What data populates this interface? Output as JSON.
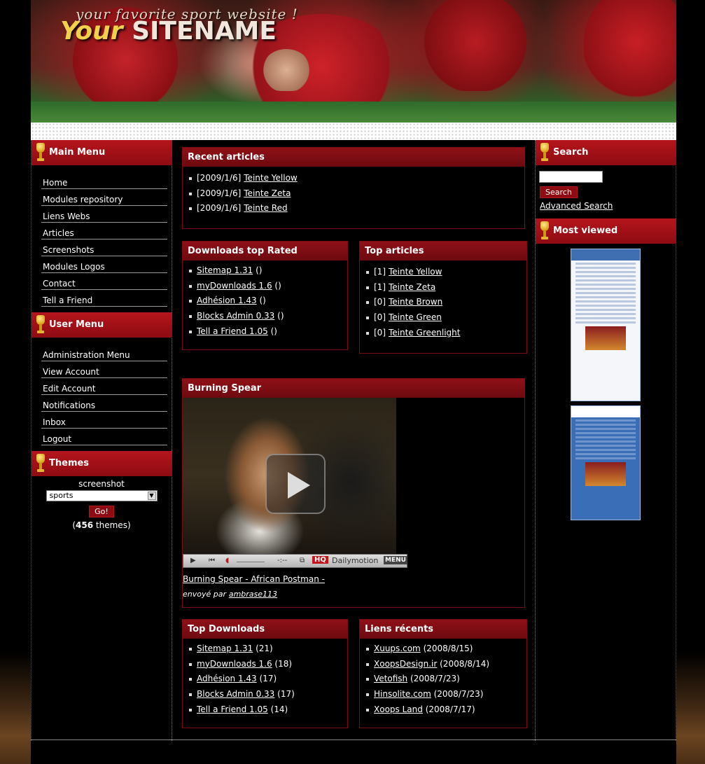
{
  "header": {
    "tagline": "your favorite sport website !",
    "site_name_part1": "Your",
    "site_name_part2": "SITENAME"
  },
  "main_menu": {
    "title": "Main Menu",
    "items": [
      "Home",
      "Modules repository",
      "Liens Webs",
      "Articles",
      "Screenshots",
      "Modules Logos",
      "Contact",
      "Tell a Friend"
    ]
  },
  "user_menu": {
    "title": "User Menu",
    "items": [
      "Administration Menu",
      "View Account",
      "Edit Account",
      "Notifications",
      "Inbox",
      "Logout"
    ]
  },
  "themes": {
    "title": "Themes",
    "label": "screenshot",
    "selected": "sports",
    "go_label": "Go!",
    "count_open": "(",
    "count": "456",
    "count_close": " themes)"
  },
  "recent_articles": {
    "title": "Recent articles",
    "items": [
      {
        "date": "[2009/1/6]",
        "title": "Teinte Yellow"
      },
      {
        "date": "[2009/1/6]",
        "title": "Teinte Zeta"
      },
      {
        "date": "[2009/1/6]",
        "title": "Teinte Red"
      }
    ]
  },
  "downloads_top_rated": {
    "title": "Downloads top Rated",
    "items": [
      {
        "name": "Sitemap 1.31",
        "value": "()"
      },
      {
        "name": "myDownloads 1.6",
        "value": "()"
      },
      {
        "name": "Adhésion 1.43",
        "value": "()"
      },
      {
        "name": "Blocks Admin 0.33",
        "value": "()"
      },
      {
        "name": "Tell a Friend 1.05",
        "value": "()"
      }
    ]
  },
  "top_articles": {
    "title": "Top articles",
    "items": [
      {
        "count": "[1]",
        "title": "Teinte Yellow"
      },
      {
        "count": "[1]",
        "title": "Teinte Zeta"
      },
      {
        "count": "[0]",
        "title": "Teinte Brown"
      },
      {
        "count": "[0]",
        "title": "Teinte Green"
      },
      {
        "count": "[0]",
        "title": "Teinte Greenlight"
      }
    ]
  },
  "video_block": {
    "title": "Burning Spear",
    "hq": "HQ",
    "brand": "Dailymotion",
    "menu": "MENU",
    "time": "-:--",
    "caption": "Burning Spear - African Postman -",
    "sent_by": "envoyé par",
    "author": "ambrase113"
  },
  "top_downloads": {
    "title": "Top Downloads",
    "items": [
      {
        "name": "Sitemap 1.31",
        "value": "(21)"
      },
      {
        "name": "myDownloads 1.6",
        "value": "(18)"
      },
      {
        "name": "Adhésion 1.43",
        "value": "(17)"
      },
      {
        "name": "Blocks Admin 0.33",
        "value": "(17)"
      },
      {
        "name": "Tell a Friend 1.05",
        "value": "(14)"
      }
    ]
  },
  "recent_links": {
    "title": "Liens récents",
    "items": [
      {
        "name": "Xuups.com",
        "date": "(2008/8/15)"
      },
      {
        "name": "XoopsDesign.ir",
        "date": "(2008/8/14)"
      },
      {
        "name": "Vetofish",
        "date": "(2008/7/23)"
      },
      {
        "name": "Hinsolite.com",
        "date": "(2008/7/23)"
      },
      {
        "name": "Xoops Land",
        "date": "(2008/7/17)"
      }
    ]
  },
  "search": {
    "title": "Search",
    "button": "Search",
    "advanced": "Advanced Search"
  },
  "most_viewed": {
    "title": "Most viewed"
  },
  "colors": {
    "accent": "#8e0b12",
    "background": "#000000",
    "strip": "#ffffff"
  }
}
